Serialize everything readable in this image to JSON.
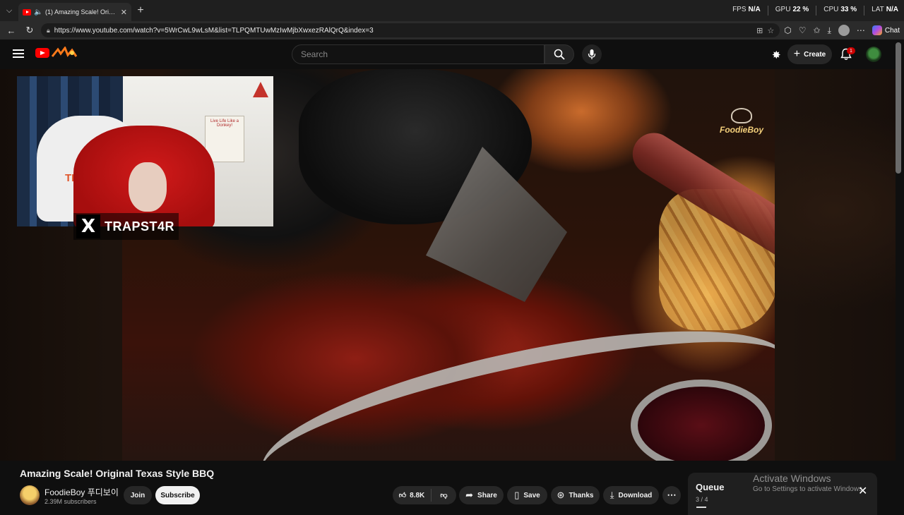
{
  "browser": {
    "tab_title": "(1) Amazing Scale! Original Te",
    "tab_close": "✕",
    "new_tab": "+",
    "url": "https://www.youtube.com/watch?v=5WrCwL9wLsM&list=TLPQMTUwMzIwMjbXwxezRAlQrQ&index=3",
    "copilot_label": "Chat",
    "perf": [
      {
        "label": "FPS",
        "value": "N/A"
      },
      {
        "label": "GPU",
        "value": "22 %"
      },
      {
        "label": "CPU",
        "value": "33 %"
      },
      {
        "label": "LAT",
        "value": "N/A"
      }
    ]
  },
  "youtube": {
    "search_placeholder": "Search",
    "create_label": "Create",
    "notification_count": "1",
    "video_watermark": "FoodieBoy",
    "streamer_handle": "TRAPST4R",
    "streamer_x_logo": "X",
    "chair_text": "TRAPS",
    "poster_text": "Live Life Like a Donkey!",
    "video_title": "Amazing Scale! Original Texas Style BBQ",
    "channel_name": "FoodieBoy 푸디보이",
    "subscribers": "2.39M subscribers",
    "join_label": "Join",
    "subscribe_label": "Subscribe",
    "likes": "8.8K",
    "share_label": "Share",
    "save_label": "Save",
    "thanks_label": "Thanks",
    "download_label": "Download",
    "queue_title": "Queue",
    "queue_position": "3 / 4"
  },
  "windows_watermark": {
    "line1": "Activate Windows",
    "line2": "Go to Settings to activate Windows."
  }
}
